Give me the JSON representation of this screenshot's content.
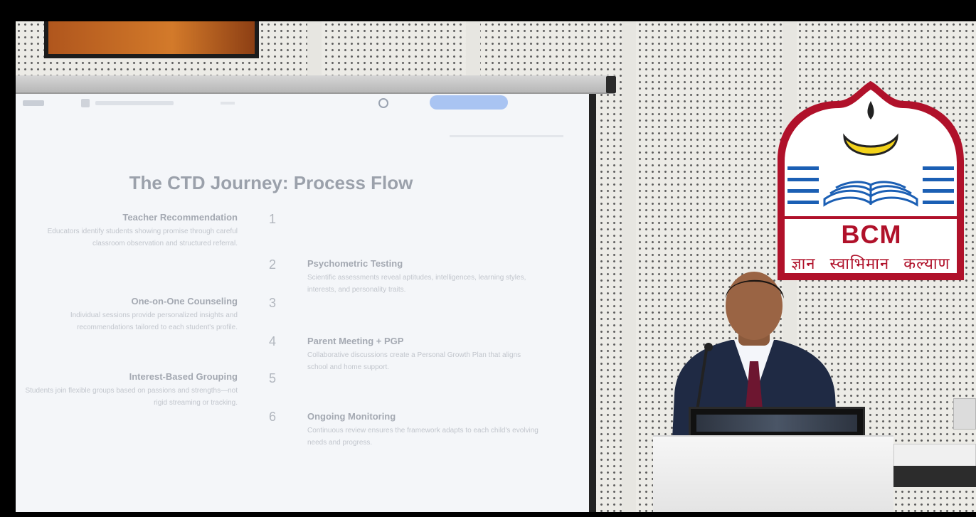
{
  "slide": {
    "title": "The CTD Journey: Process Flow",
    "steps": [
      {
        "num": "1",
        "title": "Teacher Recommendation",
        "desc": "Educators identify students showing promise through careful classroom observation and structured referral."
      },
      {
        "num": "2",
        "title": "Psychometric Testing",
        "desc": "Scientific assessments reveal aptitudes, intelligences, learning styles, interests, and personality traits."
      },
      {
        "num": "3",
        "title": "One-on-One Counseling",
        "desc": "Individual sessions provide personalized insights and recommendations tailored to each student's profile."
      },
      {
        "num": "4",
        "title": "Parent Meeting + PGP",
        "desc": "Collaborative discussions create a Personal Growth Plan that aligns school and home support."
      },
      {
        "num": "5",
        "title": "Interest-Based Grouping",
        "desc": "Students join flexible groups based on passions and strengths—not rigid streaming or tracking."
      },
      {
        "num": "6",
        "title": "Ongoing Monitoring",
        "desc": "Continuous review ensures the framework adapts to each child's evolving needs and progress."
      }
    ]
  },
  "logo": {
    "name": "BCM",
    "motto": "ज्ञान स्वाभिमान कल्याण",
    "colors": {
      "border": "#b0112a",
      "flame": "#f3d21a",
      "lines": "#1b5fb4"
    }
  },
  "icons": [
    "user-icon",
    "document-icon",
    "lamp-icon",
    "book-icon"
  ]
}
